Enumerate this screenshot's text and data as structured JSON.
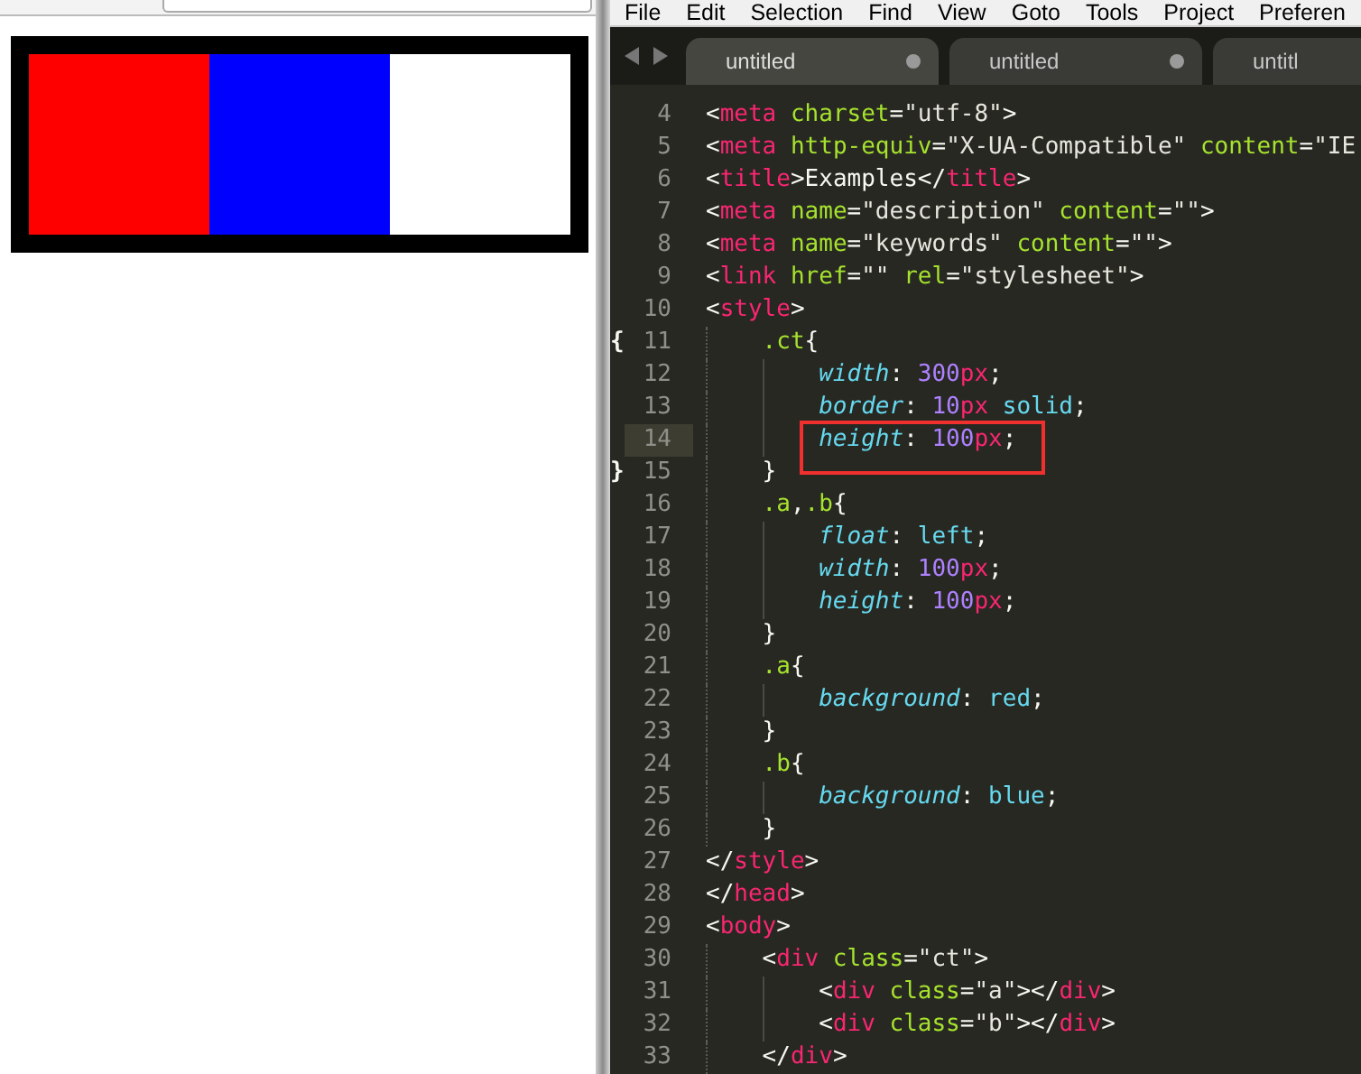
{
  "browser": {
    "demo_blocks": [
      {
        "color": "#ff0000"
      },
      {
        "color": "#0000ff"
      }
    ]
  },
  "editor": {
    "menu": [
      "File",
      "Edit",
      "Selection",
      "Find",
      "View",
      "Goto",
      "Tools",
      "Project",
      "Preferen"
    ],
    "tabs": [
      {
        "label": "untitled",
        "selected": true,
        "modified": true
      },
      {
        "label": "untitled",
        "selected": false,
        "modified": true
      },
      {
        "label": "untitl",
        "selected": false
      }
    ],
    "lines": [
      {
        "number": "4",
        "kind": "top",
        "current": false,
        "boxed": false,
        "tokens": [
          {
            "kind": "punct",
            "text": "<"
          },
          {
            "kind": "tag",
            "text": "meta"
          },
          {
            "kind": "attr",
            "text": " charset"
          },
          {
            "kind": "punct",
            "text": "="
          },
          {
            "kind": "str",
            "text": "\"utf-8\""
          },
          {
            "kind": "punct",
            "text": ">"
          }
        ]
      },
      {
        "number": "5",
        "kind": "top",
        "current": false,
        "boxed": false,
        "tokens": [
          {
            "kind": "punct",
            "text": "<"
          },
          {
            "kind": "tag",
            "text": "meta"
          },
          {
            "kind": "attr",
            "text": " http-equiv"
          },
          {
            "kind": "punct",
            "text": "="
          },
          {
            "kind": "str",
            "text": "\"X-UA-Compatible\""
          },
          {
            "kind": "attr",
            "text": " content"
          },
          {
            "kind": "punct",
            "text": "="
          },
          {
            "kind": "str",
            "text": "\"IE"
          }
        ]
      },
      {
        "number": "6",
        "kind": "top",
        "current": false,
        "boxed": false,
        "tokens": [
          {
            "kind": "punct",
            "text": "<"
          },
          {
            "kind": "tag",
            "text": "title"
          },
          {
            "kind": "punct",
            "text": ">Examples</"
          },
          {
            "kind": "tag",
            "text": "title"
          },
          {
            "kind": "punct",
            "text": ">"
          }
        ]
      },
      {
        "number": "7",
        "kind": "top",
        "current": false,
        "boxed": false,
        "tokens": [
          {
            "kind": "punct",
            "text": "<"
          },
          {
            "kind": "tag",
            "text": "meta"
          },
          {
            "kind": "attr",
            "text": " name"
          },
          {
            "kind": "punct",
            "text": "="
          },
          {
            "kind": "str",
            "text": "\"description\""
          },
          {
            "kind": "attr",
            "text": " content"
          },
          {
            "kind": "punct",
            "text": "="
          },
          {
            "kind": "str",
            "text": "\"\""
          },
          {
            "kind": "punct",
            "text": ">"
          }
        ]
      },
      {
        "number": "8",
        "kind": "top",
        "current": false,
        "boxed": false,
        "tokens": [
          {
            "kind": "punct",
            "text": "<"
          },
          {
            "kind": "tag",
            "text": "meta"
          },
          {
            "kind": "attr",
            "text": " name"
          },
          {
            "kind": "punct",
            "text": "="
          },
          {
            "kind": "str",
            "text": "\"keywords\""
          },
          {
            "kind": "attr",
            "text": " content"
          },
          {
            "kind": "punct",
            "text": "="
          },
          {
            "kind": "str",
            "text": "\"\""
          },
          {
            "kind": "punct",
            "text": ">"
          }
        ]
      },
      {
        "number": "9",
        "kind": "top",
        "current": false,
        "boxed": false,
        "tokens": [
          {
            "kind": "punct",
            "text": "<"
          },
          {
            "kind": "tag",
            "text": "link"
          },
          {
            "kind": "attr",
            "text": " href"
          },
          {
            "kind": "punct",
            "text": "="
          },
          {
            "kind": "str",
            "text": "\"\""
          },
          {
            "kind": "attr",
            "text": " rel"
          },
          {
            "kind": "punct",
            "text": "="
          },
          {
            "kind": "str",
            "text": "\"stylesheet\""
          },
          {
            "kind": "punct",
            "text": ">"
          }
        ]
      },
      {
        "number": "10",
        "kind": "top",
        "current": false,
        "boxed": false,
        "tokens": [
          {
            "kind": "punct",
            "text": "<"
          },
          {
            "kind": "tag",
            "text": "style"
          },
          {
            "kind": "punct",
            "text": ">"
          }
        ]
      },
      {
        "number": "11",
        "kind": "nested",
        "current": false,
        "boxed": false,
        "fold": "{",
        "tokens": [
          {
            "kind": "sel",
            "text": ".ct"
          },
          {
            "kind": "punct",
            "text": "{"
          }
        ]
      },
      {
        "number": "12",
        "kind": "deep",
        "current": false,
        "boxed": false,
        "tokens": [
          {
            "kind": "prop",
            "text": "width"
          },
          {
            "kind": "punct",
            "text": ": "
          },
          {
            "kind": "num",
            "text": "300"
          },
          {
            "kind": "unit",
            "text": "px"
          },
          {
            "kind": "punct",
            "text": ";"
          }
        ]
      },
      {
        "number": "13",
        "kind": "deep",
        "current": false,
        "boxed": false,
        "tokens": [
          {
            "kind": "prop",
            "text": "border"
          },
          {
            "kind": "punct",
            "text": ": "
          },
          {
            "kind": "num",
            "text": "10"
          },
          {
            "kind": "unit",
            "text": "px"
          },
          {
            "kind": "val",
            "text": " solid"
          },
          {
            "kind": "punct",
            "text": ";"
          }
        ]
      },
      {
        "number": "14",
        "kind": "deep",
        "current": true,
        "boxed": true,
        "tokens": [
          {
            "kind": "prop",
            "text": "height"
          },
          {
            "kind": "punct",
            "text": ": "
          },
          {
            "kind": "num",
            "text": "100"
          },
          {
            "kind": "unit",
            "text": "px"
          },
          {
            "kind": "punct",
            "text": ";"
          }
        ]
      },
      {
        "number": "15",
        "kind": "nested",
        "current": false,
        "boxed": false,
        "fold": "}",
        "tokens": [
          {
            "kind": "punct",
            "text": "}"
          }
        ]
      },
      {
        "number": "16",
        "kind": "nested",
        "current": false,
        "boxed": false,
        "tokens": [
          {
            "kind": "sel",
            "text": ".a"
          },
          {
            "kind": "punct",
            "text": ","
          },
          {
            "kind": "sel",
            "text": ".b"
          },
          {
            "kind": "punct",
            "text": "{"
          }
        ]
      },
      {
        "number": "17",
        "kind": "deep",
        "current": false,
        "boxed": false,
        "tokens": [
          {
            "kind": "prop",
            "text": "float"
          },
          {
            "kind": "punct",
            "text": ": "
          },
          {
            "kind": "val",
            "text": "left"
          },
          {
            "kind": "punct",
            "text": ";"
          }
        ]
      },
      {
        "number": "18",
        "kind": "deep",
        "current": false,
        "boxed": false,
        "tokens": [
          {
            "kind": "prop",
            "text": "width"
          },
          {
            "kind": "punct",
            "text": ": "
          },
          {
            "kind": "num",
            "text": "100"
          },
          {
            "kind": "unit",
            "text": "px"
          },
          {
            "kind": "punct",
            "text": ";"
          }
        ]
      },
      {
        "number": "19",
        "kind": "deep",
        "current": false,
        "boxed": false,
        "tokens": [
          {
            "kind": "prop",
            "text": "height"
          },
          {
            "kind": "punct",
            "text": ": "
          },
          {
            "kind": "num",
            "text": "100"
          },
          {
            "kind": "unit",
            "text": "px"
          },
          {
            "kind": "punct",
            "text": ";"
          }
        ]
      },
      {
        "number": "20",
        "kind": "nested",
        "current": false,
        "boxed": false,
        "tokens": [
          {
            "kind": "punct",
            "text": "}"
          }
        ]
      },
      {
        "number": "21",
        "kind": "nested",
        "current": false,
        "boxed": false,
        "tokens": [
          {
            "kind": "sel",
            "text": ".a"
          },
          {
            "kind": "punct",
            "text": "{"
          }
        ]
      },
      {
        "number": "22",
        "kind": "deep",
        "current": false,
        "boxed": false,
        "tokens": [
          {
            "kind": "prop",
            "text": "background"
          },
          {
            "kind": "punct",
            "text": ": "
          },
          {
            "kind": "val",
            "text": "red"
          },
          {
            "kind": "punct",
            "text": ";"
          }
        ]
      },
      {
        "number": "23",
        "kind": "nested",
        "current": false,
        "boxed": false,
        "tokens": [
          {
            "kind": "punct",
            "text": "}"
          }
        ]
      },
      {
        "number": "24",
        "kind": "nested",
        "current": false,
        "boxed": false,
        "tokens": [
          {
            "kind": "sel",
            "text": ".b"
          },
          {
            "kind": "punct",
            "text": "{"
          }
        ]
      },
      {
        "number": "25",
        "kind": "deep",
        "current": false,
        "boxed": false,
        "tokens": [
          {
            "kind": "prop",
            "text": "background"
          },
          {
            "kind": "punct",
            "text": ": "
          },
          {
            "kind": "val",
            "text": "blue"
          },
          {
            "kind": "punct",
            "text": ";"
          }
        ]
      },
      {
        "number": "26",
        "kind": "nested",
        "current": false,
        "boxed": false,
        "tokens": [
          {
            "kind": "punct",
            "text": "}"
          }
        ]
      },
      {
        "number": "27",
        "kind": "top",
        "current": false,
        "boxed": false,
        "tokens": [
          {
            "kind": "punct",
            "text": "</"
          },
          {
            "kind": "tag",
            "text": "style"
          },
          {
            "kind": "punct",
            "text": ">"
          }
        ]
      },
      {
        "number": "28",
        "kind": "top",
        "current": false,
        "boxed": false,
        "tokens": [
          {
            "kind": "punct",
            "text": "</"
          },
          {
            "kind": "tag",
            "text": "head"
          },
          {
            "kind": "punct",
            "text": ">"
          }
        ]
      },
      {
        "number": "29",
        "kind": "top",
        "current": false,
        "boxed": false,
        "tokens": [
          {
            "kind": "punct",
            "text": "<"
          },
          {
            "kind": "tag",
            "text": "body"
          },
          {
            "kind": "punct",
            "text": ">"
          }
        ]
      },
      {
        "number": "30",
        "kind": "nested",
        "current": false,
        "boxed": false,
        "tokens": [
          {
            "kind": "punct",
            "text": "<"
          },
          {
            "kind": "tag",
            "text": "div"
          },
          {
            "kind": "attr",
            "text": " class"
          },
          {
            "kind": "punct",
            "text": "="
          },
          {
            "kind": "str",
            "text": "\"ct\""
          },
          {
            "kind": "punct",
            "text": ">"
          }
        ]
      },
      {
        "number": "31",
        "kind": "deep",
        "current": false,
        "boxed": false,
        "tokens": [
          {
            "kind": "punct",
            "text": "<"
          },
          {
            "kind": "tag",
            "text": "div"
          },
          {
            "kind": "attr",
            "text": " class"
          },
          {
            "kind": "punct",
            "text": "="
          },
          {
            "kind": "str",
            "text": "\"a\""
          },
          {
            "kind": "punct",
            "text": "></"
          },
          {
            "kind": "tag",
            "text": "div"
          },
          {
            "kind": "punct",
            "text": ">"
          }
        ]
      },
      {
        "number": "32",
        "kind": "deep",
        "current": false,
        "boxed": false,
        "tokens": [
          {
            "kind": "punct",
            "text": "<"
          },
          {
            "kind": "tag",
            "text": "div"
          },
          {
            "kind": "attr",
            "text": " class"
          },
          {
            "kind": "punct",
            "text": "="
          },
          {
            "kind": "str",
            "text": "\"b\""
          },
          {
            "kind": "punct",
            "text": "></"
          },
          {
            "kind": "tag",
            "text": "div"
          },
          {
            "kind": "punct",
            "text": ">"
          }
        ]
      },
      {
        "number": "33",
        "kind": "nested",
        "current": false,
        "boxed": false,
        "tokens": [
          {
            "kind": "punct",
            "text": "</"
          },
          {
            "kind": "tag",
            "text": "div"
          },
          {
            "kind": "punct",
            "text": ">"
          }
        ]
      }
    ]
  }
}
